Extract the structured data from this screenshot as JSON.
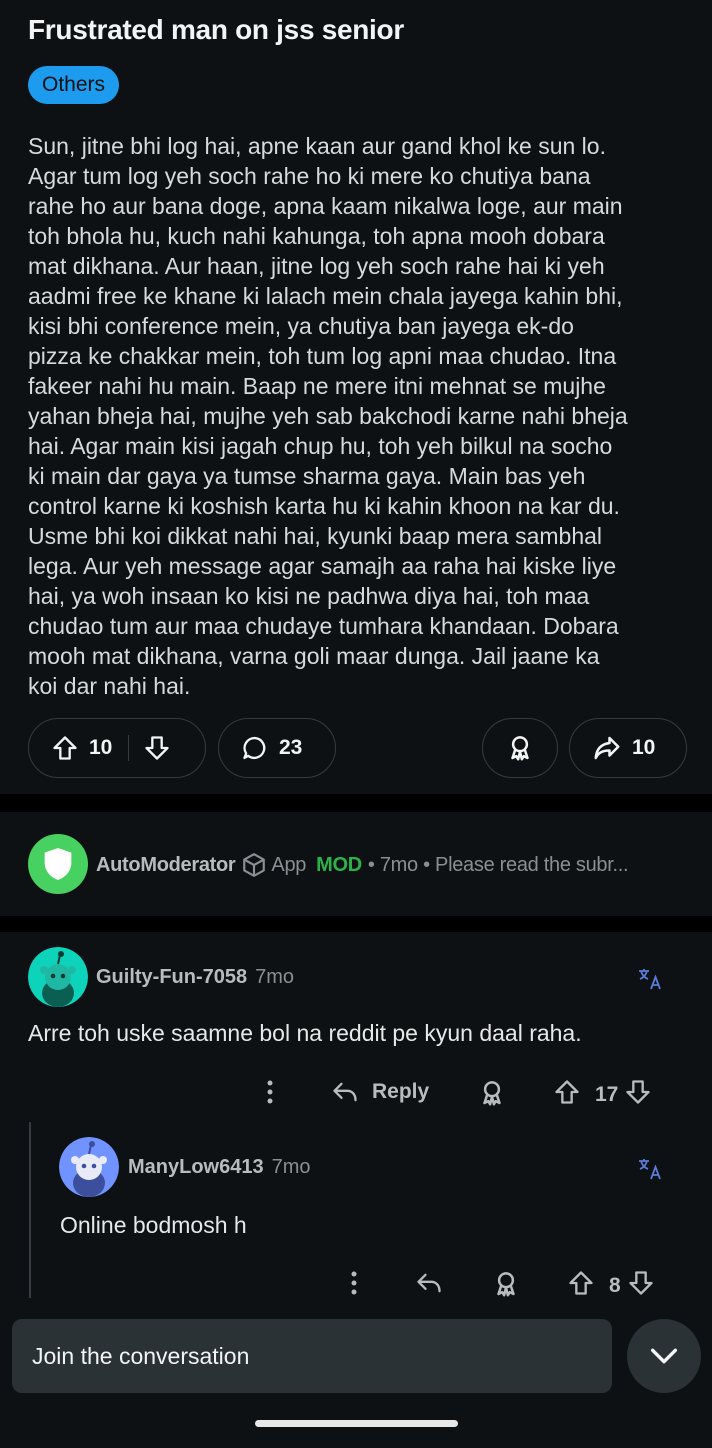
{
  "post": {
    "title": "Frustrated man on jss senior",
    "flair": "Others",
    "body": "Sun, jitne bhi log hai, apne kaan aur gand khol ke sun lo.\nAgar tum log yeh soch rahe ho ki mere ko chutiya bana\nrahe ho aur bana doge, apna kaam nikalwa loge, aur main\ntoh bhola hu, kuch nahi kahunga, toh apna mooh dobara\nmat dikhana. Aur haan, jitne log yeh soch rahe hai ki yeh\naadmi free ke khane ki lalach mein chala jayega kahin bhi,\nkisi bhi conference mein, ya chutiya ban jayega ek-do\npizza ke chakkar mein, toh tum log apni maa chudao. Itna\nfakeer nahi hu main. Baap ne mere itni mehnat se mujhe\nyahan bheja hai, mujhe yeh sab bakchodi karne nahi bheja\nhai. Agar main kisi jagah chup hu, toh yeh bilkul na socho\nki main dar gaya ya tumse sharma gaya. Main bas yeh\ncontrol karne ki koshish karta hu ki kahin khoon na kar du.\nUsme bhi koi dikkat nahi hai, kyunki baap mera sambhal\nlega. Aur yeh message agar samajh aa raha hai kiske liye\nhai, ya woh insaan ko kisi ne padhwa diya hai, toh maa\nchudao tum aur maa chudaye tumhara khandaan. Dobara\nmooh mat dikhana, varna goli maar dunga. Jail jaane ka\nkoi dar nahi hai.",
    "votes": "10",
    "comments": "23",
    "shares": "10"
  },
  "automod": {
    "username": "AutoModerator",
    "app_label": "App",
    "mod_label": "MOD",
    "meta": "• 7mo • Please read the subr..."
  },
  "comments": [
    {
      "username": "Guilty-Fun-7058",
      "time": "7mo",
      "translate_icon": "translate-icon",
      "body": "Arre toh uske saamne bol na reddit pe kyun daal raha.",
      "reply_label": "Reply",
      "votes": "17",
      "avatar_color": "#0dd3bb"
    },
    {
      "username": "ManyLow6413",
      "time": "7mo",
      "translate_icon": "translate-icon",
      "body": "Online bodmosh h",
      "votes": "8",
      "avatar_color": "#7193ff"
    }
  ],
  "composer": {
    "placeholder": "Join the conversation"
  },
  "colors": {
    "background": "#0e1113",
    "flair": "#1c9bef",
    "mod_green": "#2bb34a",
    "automod_avatar": "#46d160"
  }
}
